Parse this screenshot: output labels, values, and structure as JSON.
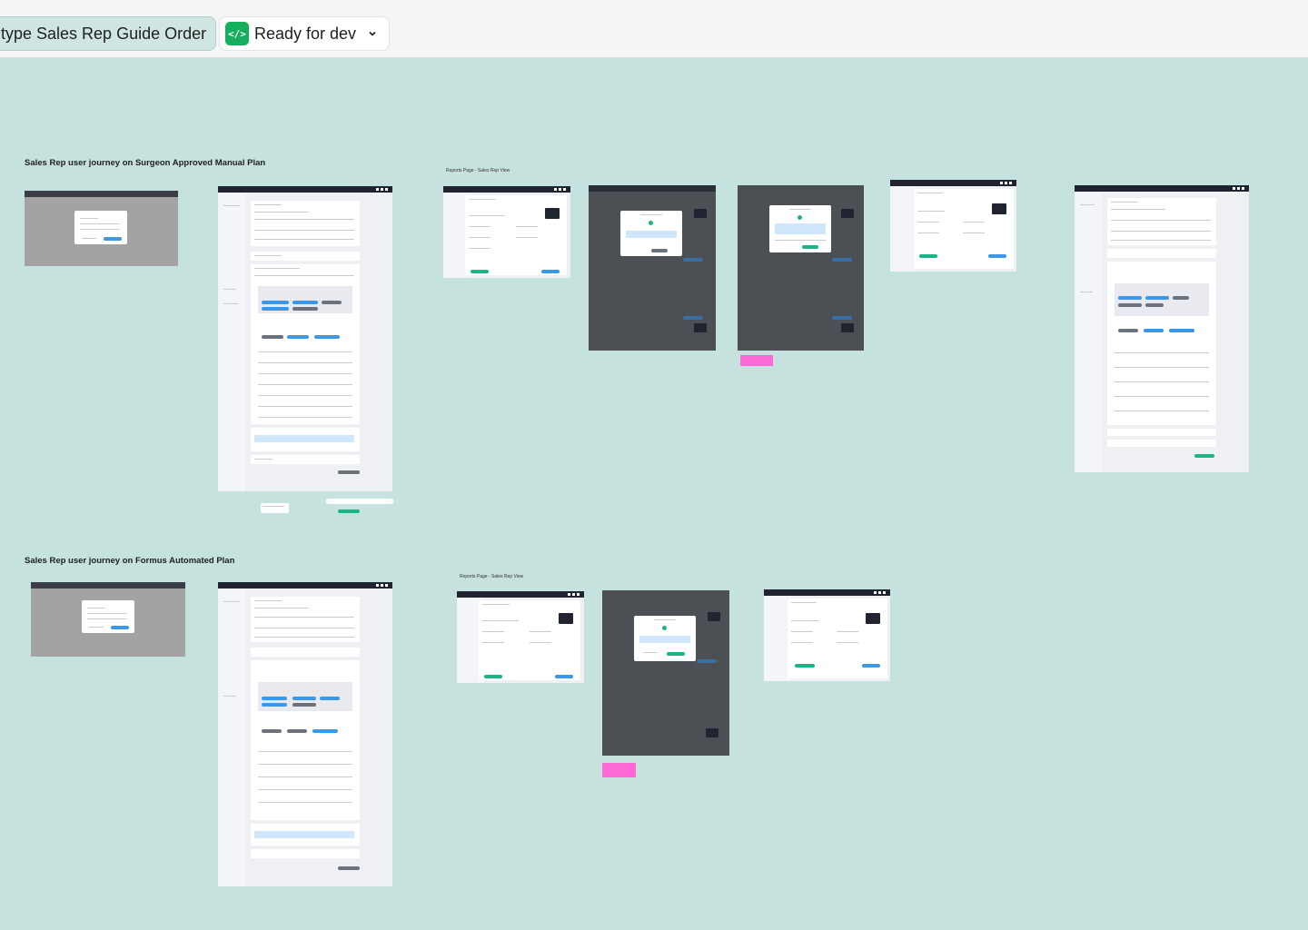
{
  "toolbar": {
    "title": "type Sales Rep Guide Order",
    "status_label": "Ready for dev",
    "status_icon": "code-brackets-icon",
    "dropdown_icon": "chevron-down-icon",
    "status_color": "#14ae5c"
  },
  "canvas": {
    "background": "#c5e2df",
    "sections": [
      {
        "label": "Sales Rep user journey on Surgeon Approved Manual Plan",
        "reports_label": "Reports Page - Sales Rep View"
      },
      {
        "label": "Sales Rep user journey on Formus Automated Plan",
        "reports_label": "Reports Page - Sales Rep View"
      }
    ]
  }
}
